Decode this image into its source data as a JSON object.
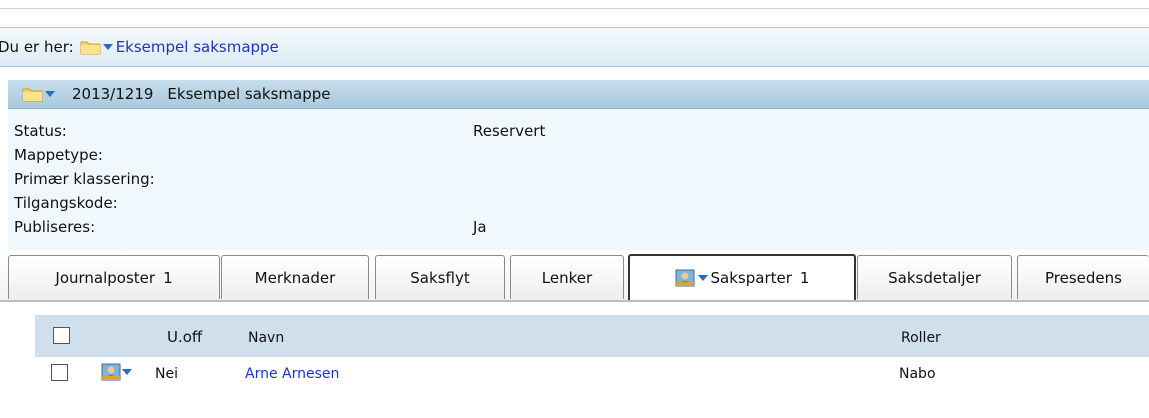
{
  "breadcrumb": {
    "label": "Du er her:",
    "link": "Eksempel saksmappe",
    "icon": "folder-icon"
  },
  "case": {
    "number": "2013/1219",
    "title": "Eksempel saksmappe",
    "fields": [
      {
        "key": "Status:",
        "value": "Reservert"
      },
      {
        "key": "Mappetype:",
        "value": ""
      },
      {
        "key": "Primær klassering:",
        "value": ""
      },
      {
        "key": "Tilgangskode:",
        "value": ""
      },
      {
        "key": "Publiseres:",
        "value": "Ja"
      }
    ]
  },
  "tabs": [
    {
      "label": "Journalposter",
      "count": "1"
    },
    {
      "label": "Merknader",
      "count": ""
    },
    {
      "label": "Saksflyt",
      "count": ""
    },
    {
      "label": "Lenker",
      "count": ""
    },
    {
      "label": "Saksparter",
      "count": "1",
      "active": true,
      "icon": "person-icon"
    },
    {
      "label": "Saksdetaljer",
      "count": ""
    },
    {
      "label": "Presedens",
      "count": ""
    }
  ],
  "grid": {
    "columns": {
      "uoff": "U.off",
      "navn": "Navn",
      "roller": "Roller"
    },
    "rows": [
      {
        "uoff": "Nei",
        "navn": "Arne Arnesen",
        "roller": "Nabo"
      }
    ]
  },
  "colors": {
    "link": "#2233bb",
    "header_band": "#a9c9dd",
    "grid_header": "#cfe0ec"
  }
}
